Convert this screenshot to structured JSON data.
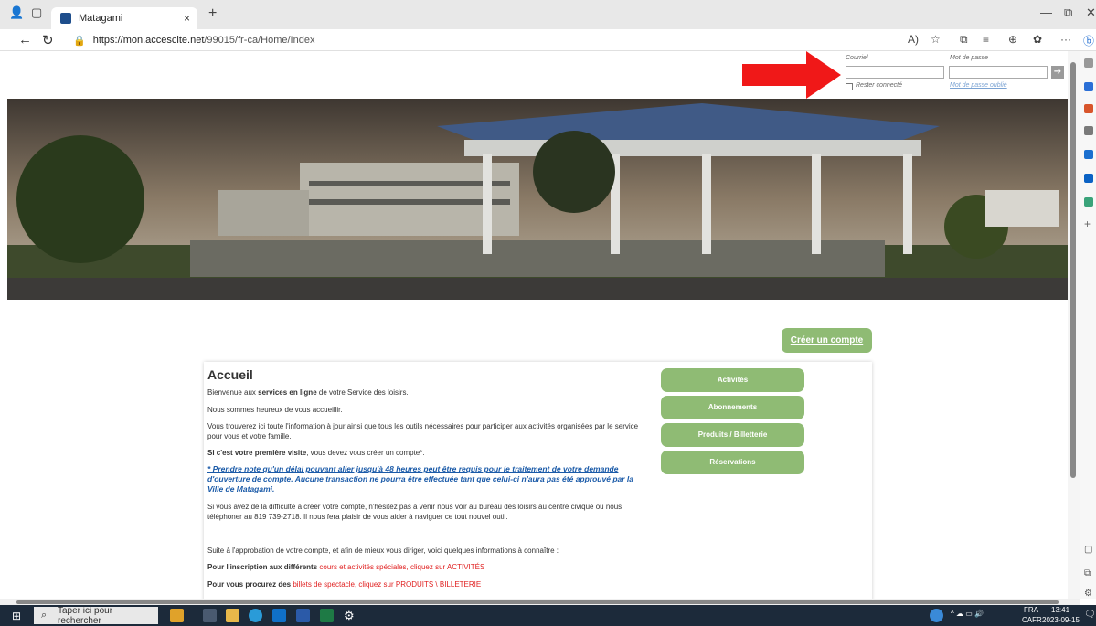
{
  "browser": {
    "tab_title": "Matagami",
    "tab_close": "×",
    "new_tab": "+",
    "url_host": "https://mon.accescite.net",
    "url_path": "/99015/fr-ca/Home/Index",
    "minimize": "—",
    "restore": "⧉",
    "close": "✕"
  },
  "login": {
    "email_label": "Courriel",
    "password_label": "Mot de passe",
    "remember_label": "Rester connecté",
    "forgot_label": "Mot de passe oublié",
    "go_glyph": "➔"
  },
  "cta": {
    "create_account": "Créer un compte"
  },
  "main": {
    "title": "Accueil",
    "p1_pre": "Bienvenue aux ",
    "p1_bold": "services en ligne",
    "p1_post": " de votre Service des loisirs.",
    "p2": "Nous sommes heureux de vous accueillir.",
    "p3": "Vous trouverez ici toute l'information à jour ainsi que tous les outils nécessaires pour participer aux activités organisées par le service pour vous et votre famille.",
    "p4_bold": "Si c'est votre première visite",
    "p4_post": ", vous devez vous créer un compte*.",
    "note": "* Prendre note qu'un délai pouvant aller jusqu'à 48 heures peut être requis pour le traitement de votre demande d'ouverture de compte. Aucune transaction ne pourra être effectuée tant que celui-ci n'aura pas été approuvé par la Ville de Matagami.",
    "p5": "Si vous avez de la difficulté à créer votre compte, n'hésitez pas à venir nous voir au bureau des loisirs au centre civique ou nous téléphoner au 819 739-2718. Il nous fera plaisir de vous aider à naviguer ce tout nouvel outil.",
    "p6": "Suite à l'approbation de votre compte, et afin de mieux vous diriger, voici quelques informations à connaître :",
    "p7_bold": "Pour l'inscription aux différents ",
    "p7_red": "cours et activités spéciales, cliquez sur ACTIVITÉS",
    "p8_bold": "Pour vous procurez des ",
    "p8_red": "billets de spectacle, cliquez sur PRODUITS \\ BILLETERIE"
  },
  "menu": [
    "Activités",
    "Abonnements",
    "Produits / Billetterie",
    "Réservations"
  ],
  "taskbar": {
    "search_placeholder": "Taper ici pour rechercher",
    "lang": "FRA",
    "lang2": "CAFR",
    "time": "13:41",
    "date": "2023-09-15"
  },
  "colors": {
    "accent_green": "#8fbb74",
    "link_blue": "#1a5aa8",
    "alert_red": "#e02020"
  },
  "icons": [
    "search-icon",
    "windows-icon",
    "back-icon",
    "refresh-icon",
    "lock-icon",
    "favorite-icon",
    "collections-icon",
    "extensions-icon",
    "more-icon",
    "red-arrow-icon"
  ]
}
